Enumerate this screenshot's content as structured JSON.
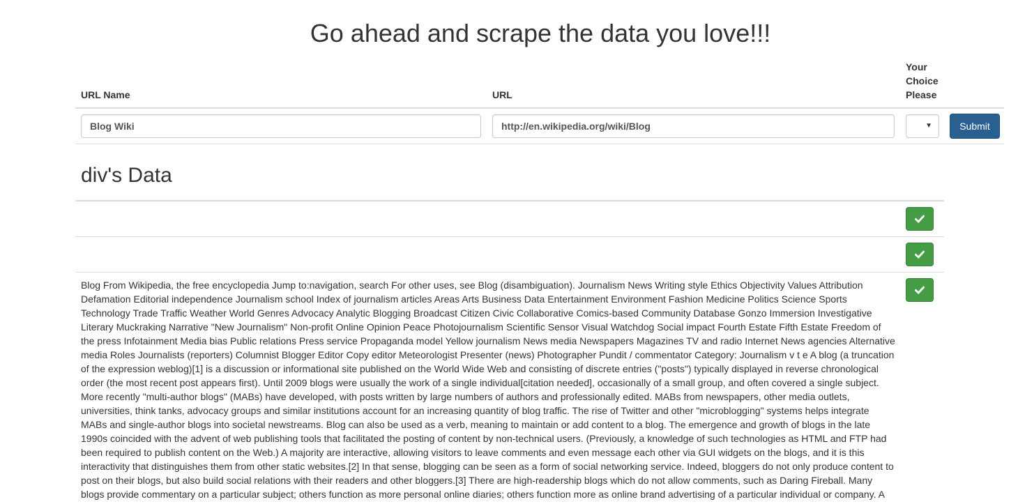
{
  "page": {
    "title": "Go ahead and scrape the data you love!!!"
  },
  "form": {
    "headers": {
      "url_name": "URL Name",
      "url": "URL",
      "choice": "Your Choice Please"
    },
    "url_name_value": "Blog Wiki",
    "url_value": "http://en.wikipedia.org/wiki/Blog",
    "choice_value": "",
    "submit_label": "Submit"
  },
  "results": {
    "section_title": "div's Data",
    "rows": [
      {
        "text": "",
        "action_icon": "check-icon"
      },
      {
        "text": "",
        "action_icon": "check-icon"
      },
      {
        "text": "Blog From Wikipedia, the free encyclopedia Jump to:navigation, search For other uses, see Blog (disambiguation). Journalism News Writing style Ethics Objectivity Values Attribution Defamation Editorial independence Journalism school Index of journalism articles Areas Arts Business Data Entertainment Environment Fashion Medicine Politics Science Sports Technology Trade Traffic Weather World Genres Advocacy Analytic Blogging Broadcast Citizen Civic Collaborative Comics-based Community Database Gonzo Immersion Investigative Literary Muckraking Narrative \"New Journalism\" Non-profit Online Opinion Peace Photojournalism Scientific Sensor Visual Watchdog Social impact Fourth Estate Fifth Estate Freedom of the press Infotainment Media bias Public relations Press service Propaganda model Yellow journalism News media Newspapers Magazines TV and radio Internet News agencies Alternative media Roles Journalists (reporters) Columnist Blogger Editor Copy editor Meteorologist Presenter (news) Photographer Pundit / commentator Category: Journalism v t e A blog (a truncation of the expression weblog)[1] is a discussion or informational site published on the World Wide Web and consisting of discrete entries (\"posts\") typically displayed in reverse chronological order (the most recent post appears first). Until 2009 blogs were usually the work of a single individual[citation needed], occasionally of a small group, and often covered a single subject. More recently \"multi-author blogs\" (MABs) have developed, with posts written by large numbers of authors and professionally edited. MABs from newspapers, other media outlets, universities, think tanks, advocacy groups and similar institutions account for an increasing quantity of blog traffic. The rise of Twitter and other \"microblogging\" systems helps integrate MABs and single-author blogs into societal newstreams. Blog can also be used as a verb, meaning to maintain or add content to a blog. The emergence and growth of blogs in the late 1990s coincided with the advent of web publishing tools that facilitated the posting of content by non-technical users. (Previously, a knowledge of such technologies as HTML and FTP had been required to publish content on the Web.) A majority are interactive, allowing visitors to leave comments and even message each other via GUI widgets on the blogs, and it is this interactivity that distinguishes them from other static websites.[2] In that sense, blogging can be seen as a form of social networking service. Indeed, bloggers do not only produce content to post on their blogs, but also build social relations with their readers and other bloggers.[3] There are high-readership blogs which do not allow comments, such as Daring Fireball. Many blogs provide commentary on a particular subject; others function as more personal online diaries; others function more as online brand advertising of a particular individual or company. A",
        "action_icon": "check-icon"
      }
    ]
  },
  "colors": {
    "primary": "#286090",
    "success": "#449d44",
    "border": "#dddddd",
    "text": "#333333"
  }
}
